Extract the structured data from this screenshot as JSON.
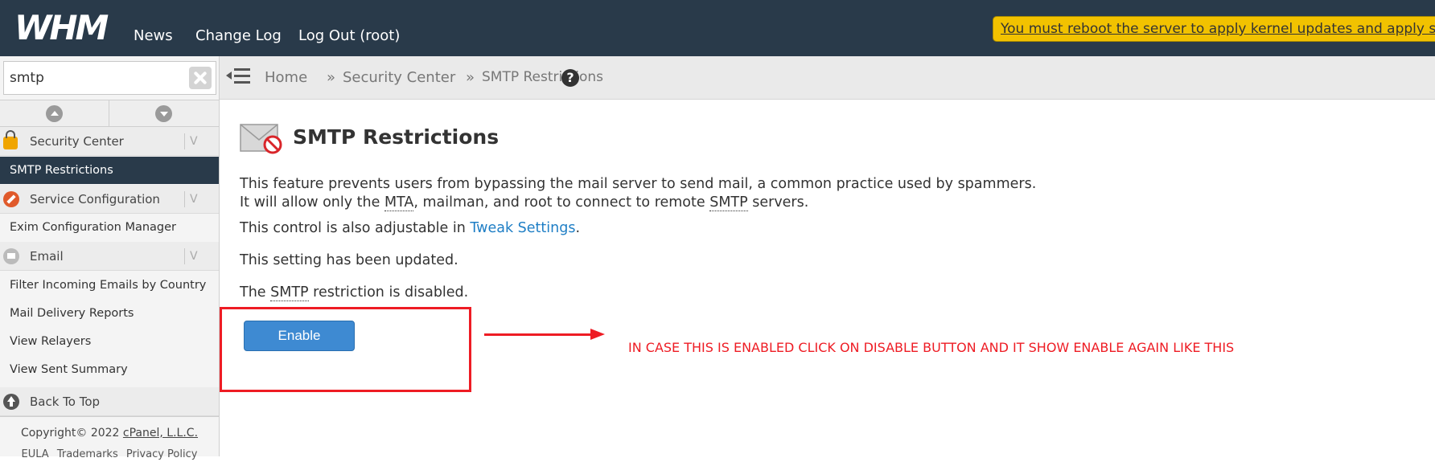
{
  "topbar": {
    "logo": "WHM",
    "nav": [
      "News",
      "Change Log",
      "Log Out (root)"
    ],
    "notice": "You must reboot the server to apply kernel updates and apply soft"
  },
  "sidebar": {
    "search_value": "smtp",
    "sections": [
      {
        "label": "Security Center",
        "icon": "lock-icon",
        "items": [
          "SMTP Restrictions"
        ]
      },
      {
        "label": "Service Configuration",
        "icon": "wrench-icon",
        "items": [
          "Exim Configuration Manager"
        ]
      },
      {
        "label": "Email",
        "icon": "email-icon",
        "items": [
          "Filter Incoming Emails by Country",
          "Mail Delivery Reports",
          "View Relayers",
          "View Sent Summary"
        ]
      }
    ],
    "active_item": "SMTP Restrictions",
    "back_to_top": "Back To Top",
    "footer": {
      "copyright": "Copyright© 2022",
      "company": "cPanel, L.L.C.",
      "links": [
        "EULA",
        "Trademarks",
        "Privacy Policy"
      ]
    }
  },
  "breadcrumb": {
    "items": [
      "Home",
      "Security Center",
      "SMTP Restrictions"
    ],
    "separator": "»"
  },
  "main": {
    "title": "SMTP Restrictions",
    "desc_line1": "This feature prevents users from bypassing the mail server to send mail, a common practice used by spammers.",
    "desc_line2_pre": "It will allow only the ",
    "desc_line2_abbr1": "MTA",
    "desc_line2_mid": ", mailman, and root to connect to remote ",
    "desc_line2_abbr2": "SMTP",
    "desc_line2_post": " servers.",
    "tweak_pre": "This control is also adjustable in ",
    "tweak_link": "Tweak Settings",
    "tweak_post": ".",
    "updated": "This setting has been updated.",
    "status_pre": "The ",
    "status_abbr": "SMTP",
    "status_post": " restriction is disabled.",
    "button": "Enable"
  },
  "annotation": {
    "text": "IN CASE THIS IS ENABLED CLICK ON DISABLE BUTTON AND IT SHOW ENABLE AGAIN LIKE THIS",
    "color": "#ee1c24"
  },
  "colors": {
    "topbar": "#293a4a",
    "notice": "#f2c200",
    "button": "#3e8ad2",
    "link": "#1e7ec5"
  }
}
